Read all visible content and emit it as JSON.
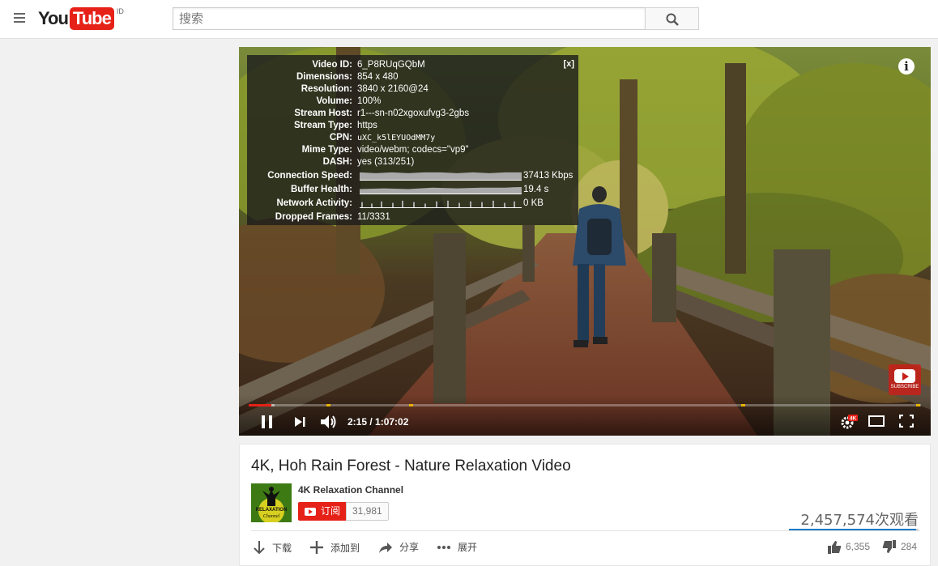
{
  "masthead": {
    "logo_you": "You",
    "logo_tube": "Tube",
    "logo_country": "ID",
    "search_placeholder": "搜索"
  },
  "player": {
    "stats": {
      "close": "[x]",
      "rows": [
        {
          "label": "Video ID:",
          "value": "6_P8RUqGQbM"
        },
        {
          "label": "Dimensions:",
          "value": "854 x 480"
        },
        {
          "label": "Resolution:",
          "value": "3840 x 2160@24"
        },
        {
          "label": "Volume:",
          "value": "100%"
        },
        {
          "label": "Stream Host:",
          "value": "r1---sn-n02xgoxufvg3-2gbs"
        },
        {
          "label": "Stream Type:",
          "value": "https"
        },
        {
          "label": "CPN:",
          "value": "uXC_k5lEYUOdMM7y"
        },
        {
          "label": "Mime Type:",
          "value": "video/webm; codecs=\"vp9\""
        },
        {
          "label": "DASH:",
          "value": "yes (313/251)"
        }
      ],
      "graphs": [
        {
          "label": "Connection Speed:",
          "value": "37413 Kbps"
        },
        {
          "label": "Buffer Health:",
          "value": "19.4 s"
        },
        {
          "label": "Network Activity:",
          "value": "0 KB"
        }
      ],
      "dropped": {
        "label": "Dropped Frames:",
        "value": "11/3331"
      }
    },
    "info_icon": "i",
    "watermark_text": "SUBSCRIBE",
    "time": "2:15 / 1:07:02",
    "progress": {
      "played": 0.034,
      "loaded": 0.038
    },
    "quality_badge": "4K"
  },
  "video": {
    "title": "4K, Hoh Rain Forest - Nature Relaxation Video",
    "channel": "4K Relaxation Channel",
    "avatar_text": "RELAXATION Channel",
    "subscribe_label": "订阅",
    "subscriber_count": "31,981",
    "views": "2,457,574次观看",
    "actions": {
      "download": "下载",
      "add_to": "添加到",
      "share": "分享",
      "more": "展开"
    },
    "likes": "6,355",
    "dislikes": "284"
  },
  "colors": {
    "brand_red": "#e62117",
    "ad_marker": "#e8b500",
    "link_blue": "#167ac6"
  }
}
